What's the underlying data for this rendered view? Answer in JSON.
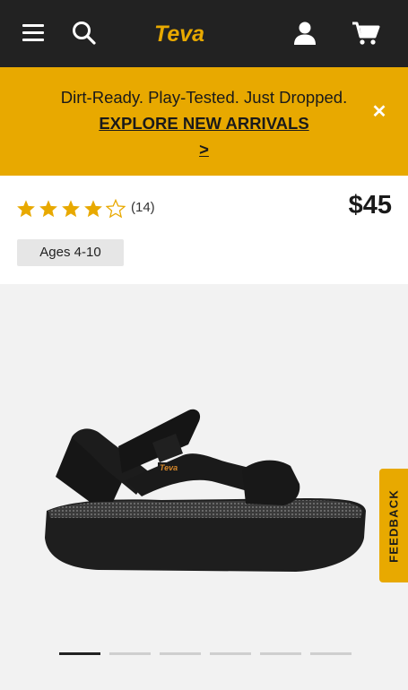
{
  "header": {
    "brand": "Teva",
    "colors": {
      "bar": "#222222",
      "logo": "#e8a900"
    }
  },
  "promo": {
    "text": "Dirt-Ready. Play-Tested. Just Dropped.",
    "link_label": "EXPLORE NEW ARRIVALS",
    "link_arrow": ">",
    "close_label": "✕",
    "background": "#e8a900"
  },
  "product": {
    "rating": 4,
    "rating_max": 5,
    "review_count": "(14)",
    "price": "$45",
    "age_badge": "Ages 4-10"
  },
  "gallery": {
    "image_count": 6,
    "active_index": 0,
    "product_logo": "Teva"
  },
  "feedback_tab": {
    "label": "FEEDBACK"
  }
}
